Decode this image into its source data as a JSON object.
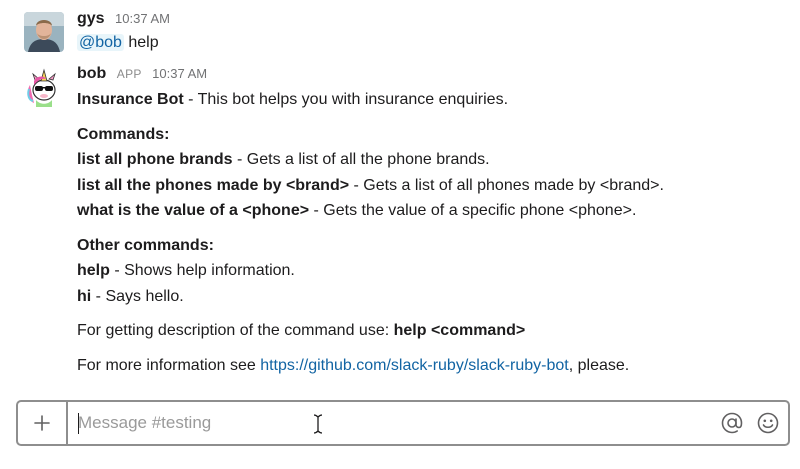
{
  "messages": [
    {
      "author": "gys",
      "timestamp": "10:37 AM",
      "avatar": "user-photo-avatar",
      "text": {
        "mention": "@bob",
        "rest": " help"
      }
    },
    {
      "author": "bob",
      "badge": "APP",
      "timestamp": "10:37 AM",
      "avatar": "unicorn-bot-avatar",
      "intro": {
        "name": "Insurance Bot",
        "desc": " - This bot helps you with insurance enquiries."
      },
      "commands_heading": "Commands:",
      "commands": [
        {
          "cmd": "list all phone brands",
          "desc": " - Gets a list of all the phone brands."
        },
        {
          "cmd": "list all the phones made by <brand>",
          "desc": " - Gets a list of all phones made by <brand>."
        },
        {
          "cmd": "what is the value of a <phone>",
          "desc": " - Gets the value of a specific phone <phone>."
        }
      ],
      "other_heading": "Other commands:",
      "other_commands": [
        {
          "cmd": "help",
          "desc": " - Shows help information."
        },
        {
          "cmd": "hi",
          "desc": " - Says hello."
        }
      ],
      "description_line": {
        "text": "For getting description of the command use: ",
        "cmd": "help <command>"
      },
      "more_info": {
        "prefix": "For more information see ",
        "link": "https://github.com/slack-ruby/slack-ruby-bot",
        "suffix": ", please."
      }
    }
  ],
  "composer": {
    "placeholder": "Message #testing",
    "value": "",
    "plus_icon": "plus-icon",
    "at_icon": "at-sign-icon",
    "emoji_icon": "emoji-icon"
  },
  "colors": {
    "link": "#1264a3",
    "mention_bg": "#e8f5fa",
    "text": "#1d1c1d",
    "muted": "#717274"
  }
}
